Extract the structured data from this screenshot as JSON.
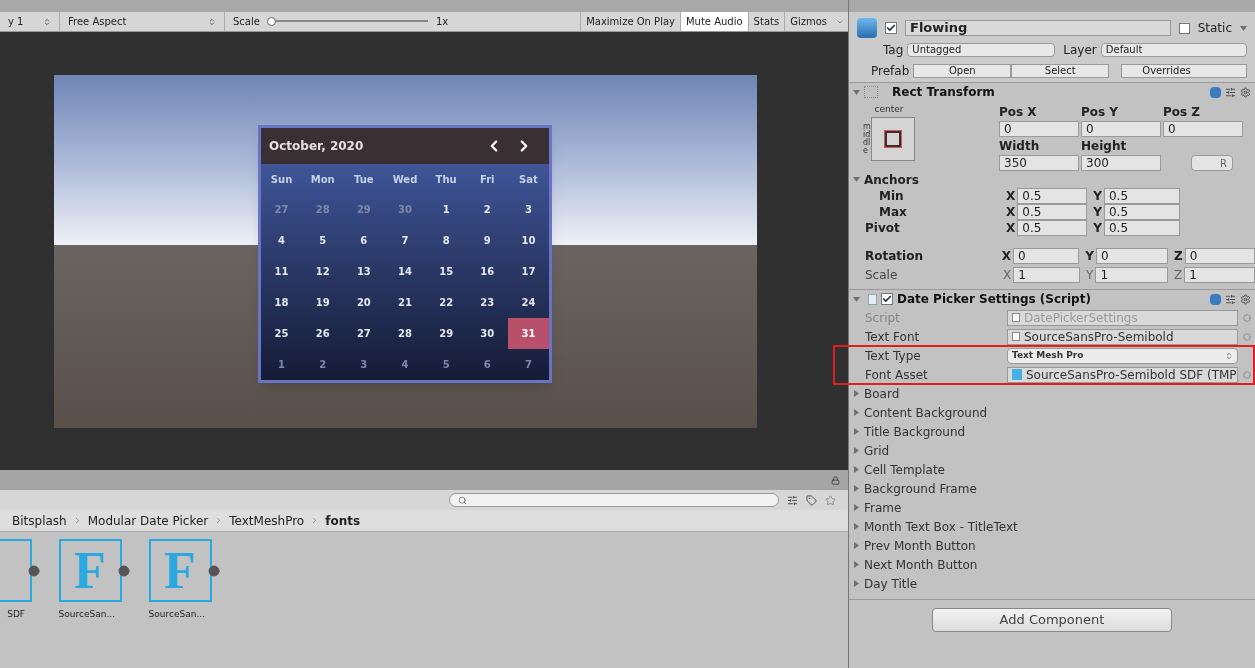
{
  "game_toolbar": {
    "display": "y 1",
    "aspect": "Free Aspect",
    "scale": {
      "label": "Scale",
      "level": 0.02,
      "value": "1x"
    },
    "buttons": [
      {
        "label": "Maximize On Play",
        "selected": false
      },
      {
        "label": "Mute Audio",
        "selected": true
      },
      {
        "label": "Stats",
        "selected": false
      },
      {
        "label": "Gizmos",
        "selected": false
      }
    ]
  },
  "calendar": {
    "title": "October, 2020",
    "weekdays": [
      "Sun",
      "Mon",
      "Tue",
      "Wed",
      "Thu",
      "Fri",
      "Sat"
    ],
    "days": [
      {
        "label": "27",
        "in_month": false,
        "selected": false
      },
      {
        "label": "28",
        "in_month": false,
        "selected": false
      },
      {
        "label": "29",
        "in_month": false,
        "selected": false
      },
      {
        "label": "30",
        "in_month": false,
        "selected": false
      },
      {
        "label": "1",
        "in_month": true,
        "selected": false
      },
      {
        "label": "2",
        "in_month": true,
        "selected": false
      },
      {
        "label": "3",
        "in_month": true,
        "selected": false
      },
      {
        "label": "4",
        "in_month": true,
        "selected": false
      },
      {
        "label": "5",
        "in_month": true,
        "selected": false
      },
      {
        "label": "6",
        "in_month": true,
        "selected": false
      },
      {
        "label": "7",
        "in_month": true,
        "selected": false
      },
      {
        "label": "8",
        "in_month": true,
        "selected": false
      },
      {
        "label": "9",
        "in_month": true,
        "selected": false
      },
      {
        "label": "10",
        "in_month": true,
        "selected": false
      },
      {
        "label": "11",
        "in_month": true,
        "selected": false
      },
      {
        "label": "12",
        "in_month": true,
        "selected": false
      },
      {
        "label": "13",
        "in_month": true,
        "selected": false
      },
      {
        "label": "14",
        "in_month": true,
        "selected": false
      },
      {
        "label": "15",
        "in_month": true,
        "selected": false
      },
      {
        "label": "16",
        "in_month": true,
        "selected": false
      },
      {
        "label": "17",
        "in_month": true,
        "selected": false
      },
      {
        "label": "18",
        "in_month": true,
        "selected": false
      },
      {
        "label": "19",
        "in_month": true,
        "selected": false
      },
      {
        "label": "20",
        "in_month": true,
        "selected": false
      },
      {
        "label": "21",
        "in_month": true,
        "selected": false
      },
      {
        "label": "22",
        "in_month": true,
        "selected": false
      },
      {
        "label": "23",
        "in_month": true,
        "selected": false
      },
      {
        "label": "24",
        "in_month": true,
        "selected": false
      },
      {
        "label": "25",
        "in_month": true,
        "selected": false
      },
      {
        "label": "26",
        "in_month": true,
        "selected": false
      },
      {
        "label": "27",
        "in_month": true,
        "selected": false
      },
      {
        "label": "28",
        "in_month": true,
        "selected": false
      },
      {
        "label": "29",
        "in_month": true,
        "selected": false
      },
      {
        "label": "30",
        "in_month": true,
        "selected": false
      },
      {
        "label": "31",
        "in_month": true,
        "selected": true
      },
      {
        "label": "1",
        "in_month": false,
        "selected": false
      },
      {
        "label": "2",
        "in_month": false,
        "selected": false
      },
      {
        "label": "3",
        "in_month": false,
        "selected": false
      },
      {
        "label": "4",
        "in_month": false,
        "selected": false
      },
      {
        "label": "5",
        "in_month": false,
        "selected": false
      },
      {
        "label": "6",
        "in_month": false,
        "selected": false
      },
      {
        "label": "7",
        "in_month": false,
        "selected": false
      }
    ]
  },
  "project": {
    "breadcrumb": [
      {
        "label": "Bitsplash",
        "current": false
      },
      {
        "label": "Modular Date Picker",
        "current": false
      },
      {
        "label": "TextMeshPro",
        "current": false
      },
      {
        "label": "fonts",
        "current": true
      }
    ],
    "assets": [
      {
        "label": "SDF"
      },
      {
        "label": "SourceSan...",
        "icon_letter": "F"
      },
      {
        "label": "SourceSan...",
        "icon_letter": "F"
      }
    ]
  },
  "inspector": {
    "active": true,
    "name": "Flowing",
    "static": false,
    "static_label": "Static",
    "tag_label": "Tag",
    "tag": "Untagged",
    "layer_label": "Layer",
    "layer": "Default",
    "prefab_label": "Prefab",
    "prefab_buttons": [
      "Open",
      "Select",
      "Overrides"
    ],
    "rect_transform": {
      "title": "Rect Transform",
      "anchor_h": "center",
      "anchor_v": "middle",
      "pos_labels": [
        "Pos X",
        "Pos Y",
        "Pos Z"
      ],
      "pos_values": [
        "0",
        "0",
        "0"
      ],
      "size_labels": [
        "Width",
        "Height"
      ],
      "size_values": [
        "350",
        "300"
      ],
      "raw_button": "R",
      "anchors_label": "Anchors",
      "rows": [
        {
          "label": "Min",
          "bold": true,
          "indent": true,
          "values": [
            {
              "axis": "X",
              "value": "0.5"
            },
            {
              "axis": "Y",
              "value": "0.5"
            }
          ]
        },
        {
          "label": "Max",
          "bold": true,
          "indent": true,
          "values": [
            {
              "axis": "X",
              "value": "0.5"
            },
            {
              "axis": "Y",
              "value": "0.5"
            }
          ]
        },
        {
          "label": "Pivot",
          "bold": true,
          "indent": false,
          "values": [
            {
              "axis": "X",
              "value": "0.5"
            },
            {
              "axis": "Y",
              "value": "0.5"
            }
          ]
        }
      ],
      "rows3": [
        {
          "label": "Rotation",
          "bold": true,
          "values": [
            {
              "axis": "X",
              "value": "0"
            },
            {
              "axis": "Y",
              "value": "0"
            },
            {
              "axis": "Z",
              "value": "0"
            }
          ]
        },
        {
          "label": "Scale",
          "bold": false,
          "values": [
            {
              "axis": "X",
              "value": "1"
            },
            {
              "axis": "Y",
              "value": "1"
            },
            {
              "axis": "Z",
              "value": "1"
            }
          ]
        }
      ]
    },
    "script": {
      "title": "Date Picker Settings (Script)",
      "enabled": true,
      "fields": [
        {
          "label": "Script",
          "value": "DatePickerSettings",
          "kind": "object",
          "disabled": true,
          "highlighted": false
        },
        {
          "label": "Text Font",
          "value": "SourceSansPro-Semibold",
          "kind": "object",
          "disabled": false,
          "highlighted": false
        },
        {
          "label": "Text Type",
          "value": "Text Mesh Pro",
          "kind": "dropdown",
          "disabled": false,
          "highlighted": true
        },
        {
          "label": "Font Asset",
          "value": "SourceSansPro-Semibold SDF (TMP",
          "kind": "asset",
          "disabled": false,
          "highlighted": true
        }
      ],
      "sections": [
        "Board",
        "Content Background",
        "Title Background",
        "Grid",
        "Cell Template",
        "Background Frame",
        "Frame",
        "Month Text Box - TitleText",
        "Prev Month Button",
        "Next Month Button",
        "Day Title"
      ]
    },
    "add_component": "Add Component"
  }
}
